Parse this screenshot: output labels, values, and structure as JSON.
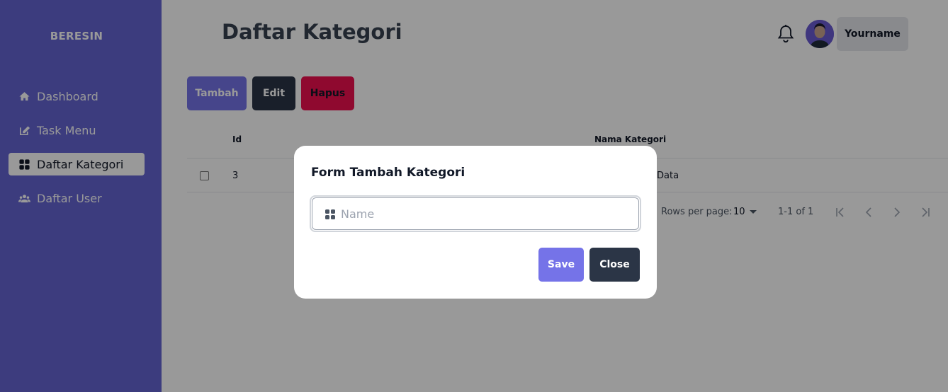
{
  "sidebar": {
    "brand": "BERESIN",
    "items": [
      {
        "label": "Dashboard",
        "icon": "home-icon"
      },
      {
        "label": "Task Menu",
        "icon": "edit-icon"
      },
      {
        "label": "Daftar Kategori",
        "icon": "grid-icon",
        "active": true
      },
      {
        "label": "Daftar User",
        "icon": "users-icon"
      }
    ]
  },
  "header": {
    "title": "Daftar Kategori",
    "user_name": "Yourname"
  },
  "toolbar": {
    "add_label": "Tambah",
    "edit_label": "Edit",
    "delete_label": "Hapus"
  },
  "table": {
    "columns": [
      "Id",
      "Nama Kategori"
    ],
    "rows": [
      {
        "id": "3",
        "name_visible": "Data"
      }
    ]
  },
  "pagination": {
    "rows_per_page_label": "Rows per page:",
    "rows_per_page_value": "10",
    "range": "1-1 of 1"
  },
  "modal": {
    "title": "Form Tambah Kategori",
    "input_placeholder": "Name",
    "input_value": "",
    "save_label": "Save",
    "close_label": "Close"
  },
  "colors": {
    "sidebar": "#6564d2",
    "primary": "#7573e8",
    "dark": "#2b3546",
    "danger": "#ef0f4f"
  }
}
